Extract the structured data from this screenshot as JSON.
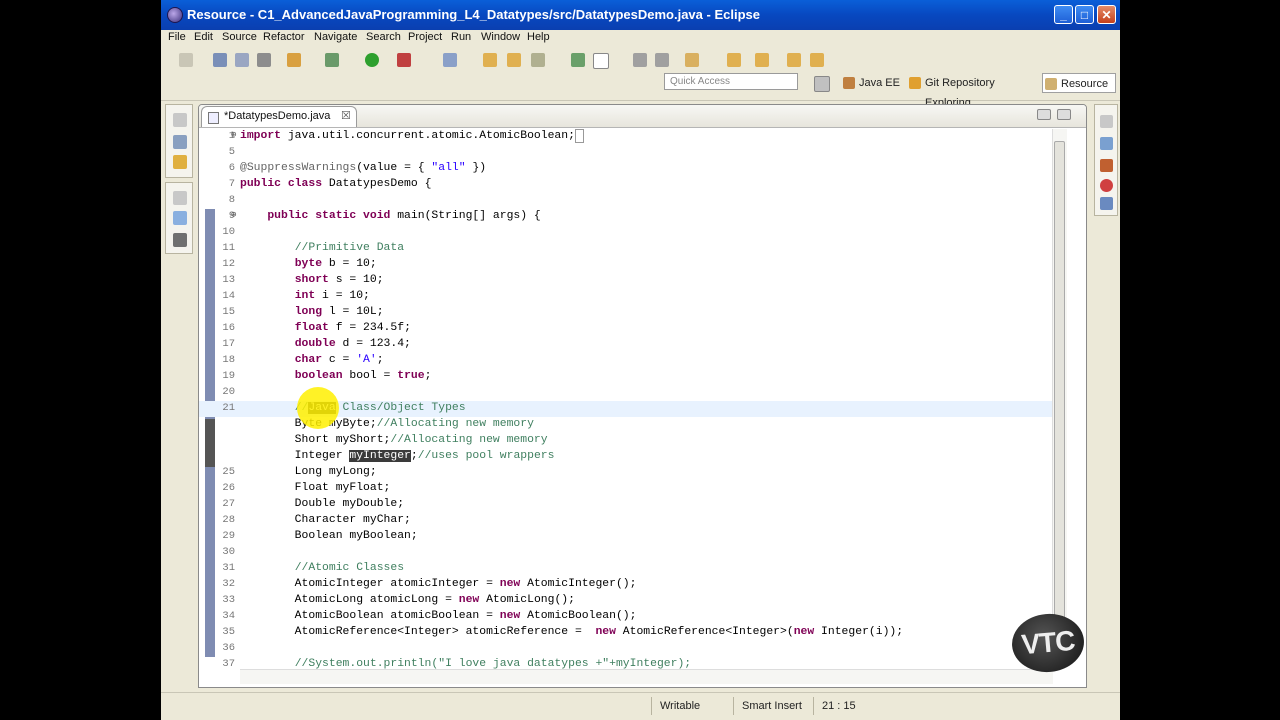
{
  "window": {
    "title": "Resource - C1_AdvancedJavaProgramming_L4_Datatypes/src/DatatypesDemo.java - Eclipse",
    "minimize": "_",
    "maximize": "□",
    "close": "✕"
  },
  "menu": [
    "File",
    "Edit",
    "Source",
    "Refactor",
    "Navigate",
    "Search",
    "Project",
    "Run",
    "Window",
    "Help"
  ],
  "quick_access": {
    "placeholder": "Quick Access"
  },
  "perspectives": [
    {
      "label": "Java EE",
      "icon": "java-ee-perspective-icon"
    },
    {
      "label": "Git Repository Exploring",
      "icon": "git-perspective-icon"
    },
    {
      "label": "Resource",
      "icon": "resource-perspective-icon",
      "active": true
    }
  ],
  "editor": {
    "tab": {
      "label": "*DatatypesDemo.java",
      "close": "☒"
    },
    "lines": [
      {
        "n": "1",
        "fold": "⊕",
        "html": "<span class='kw'>import</span> java.util.concurrent.atomic.AtomicBoolean;<span style='border:1px solid #999;'>&nbsp;</span>"
      },
      {
        "n": "5",
        "html": ""
      },
      {
        "n": "6",
        "html": "<span class='an'>@SuppressWarnings</span>(value = { <span class='st'>\"all\"</span> })"
      },
      {
        "n": "7",
        "html": "<span class='kw'>public class</span> DatatypesDemo {"
      },
      {
        "n": "8",
        "html": ""
      },
      {
        "n": "9",
        "fold": "⊖",
        "html": "    <span class='kw'>public static void</span> main(String[] args) {"
      },
      {
        "n": "10",
        "html": ""
      },
      {
        "n": "11",
        "html": "        <span class='cm'>//Primitive Data</span>"
      },
      {
        "n": "12",
        "html": "        <span class='kw'>byte</span> b = 10;"
      },
      {
        "n": "13",
        "html": "        <span class='kw'>short</span> s = 10;"
      },
      {
        "n": "14",
        "html": "        <span class='kw'>int</span> i = 10;"
      },
      {
        "n": "15",
        "html": "        <span class='kw'>long</span> l = 10L;"
      },
      {
        "n": "16",
        "html": "        <span class='kw'>float</span> f = 234.5f;"
      },
      {
        "n": "17",
        "html": "        <span class='kw'>double</span> d = 123.4;"
      },
      {
        "n": "18",
        "html": "        <span class='kw'>char</span> c = <span class='st'>'A'</span>;"
      },
      {
        "n": "19",
        "html": "        <span class='kw'>boolean</span> bool = <span class='kw'>true</span>;"
      },
      {
        "n": "20",
        "html": ""
      },
      {
        "n": "21",
        "cur": true,
        "html": "        <span class='cm'>//<span class='hlsel'>Java</span> Class/Object Types</span>"
      },
      {
        "n": "",
        "html": "        Byte myByte;<span class='cm'>//Allocating new memory</span>"
      },
      {
        "n": "",
        "html": "        Short myShort;<span class='cm'>//Allocating new memory</span>"
      },
      {
        "n": "",
        "html": "        Integer <span class='hlsel'>myInteger</span>;<span class='cm'>//uses pool wrappers</span>"
      },
      {
        "n": "25",
        "html": "        Long myLong;"
      },
      {
        "n": "26",
        "html": "        Float myFloat;"
      },
      {
        "n": "27",
        "html": "        Double myDouble;"
      },
      {
        "n": "28",
        "html": "        Character myChar;"
      },
      {
        "n": "29",
        "html": "        Boolean myBoolean;"
      },
      {
        "n": "30",
        "html": ""
      },
      {
        "n": "31",
        "html": "        <span class='cm'>//Atomic Classes</span>"
      },
      {
        "n": "32",
        "html": "        AtomicInteger atomicInteger = <span class='kw'>new</span> AtomicInteger();"
      },
      {
        "n": "33",
        "html": "        AtomicLong atomicLong = <span class='kw'>new</span> AtomicLong();"
      },
      {
        "n": "34",
        "html": "        AtomicBoolean atomicBoolean = <span class='kw'>new</span> AtomicBoolean();"
      },
      {
        "n": "35",
        "html": "        AtomicReference&lt;Integer&gt; atomicReference =  <span class='kw'>new</span> AtomicReference&lt;Integer&gt;(<span class='kw'>new</span> Integer(i));"
      },
      {
        "n": "36",
        "html": ""
      },
      {
        "n": "37",
        "html": "        <span class='cm'>//System.out.println(\"I love java datatypes +\"+myInteger);</span>"
      }
    ]
  },
  "status": {
    "writable": "Writable",
    "insert_mode": "Smart Insert",
    "position": "21 : 15"
  },
  "watermark": "VTC",
  "colors": {
    "keyword": "#7f0055",
    "comment": "#3f7f5f",
    "string": "#2a00ff",
    "titlebar": "#0848c0"
  }
}
